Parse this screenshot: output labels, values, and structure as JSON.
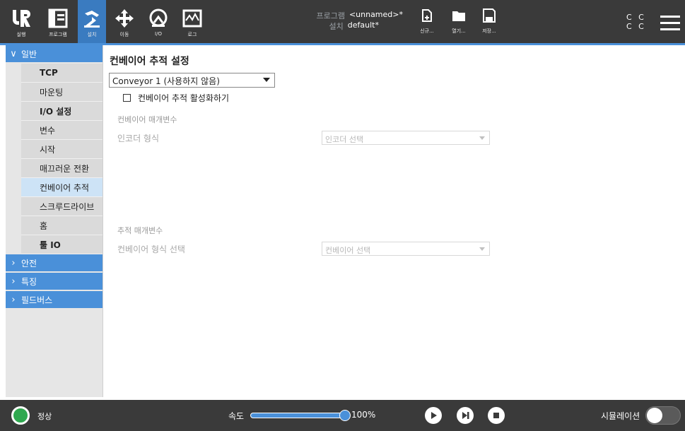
{
  "topbar": {
    "buttons": [
      {
        "label": "실행",
        "icon": "ur-logo-icon"
      },
      {
        "label": "프로그램",
        "icon": "program-icon"
      },
      {
        "label": "설치",
        "icon": "installation-icon"
      },
      {
        "label": "이동",
        "icon": "move-icon"
      },
      {
        "label": "I/O",
        "icon": "io-icon"
      },
      {
        "label": "로그",
        "icon": "log-icon"
      }
    ],
    "program_key": "프로그램",
    "program_value": "<unnamed>*",
    "install_key": "설치",
    "install_value": "default*",
    "file_buttons": [
      {
        "label": "신규...",
        "icon": "new-file-icon"
      },
      {
        "label": "열기...",
        "icon": "open-folder-icon"
      },
      {
        "label": "저장...",
        "icon": "save-icon"
      }
    ],
    "cc_line1": "C C",
    "cc_line2": "C C",
    "accent_color": "#4a90d9"
  },
  "sidebar": {
    "general_label": "일반",
    "items": [
      {
        "label": "TCP"
      },
      {
        "label": "마운팅"
      },
      {
        "label": "I/O 설정"
      },
      {
        "label": "변수"
      },
      {
        "label": "시작"
      },
      {
        "label": "매끄러운 전환"
      },
      {
        "label": "컨베이어 추적"
      },
      {
        "label": "스크루드라이브"
      },
      {
        "label": "홈"
      },
      {
        "label": "툴 IO"
      }
    ],
    "selected": "컨베이어 추적",
    "safety_label": "안전",
    "features_label": "특징",
    "fieldbus_label": "필드버스"
  },
  "main": {
    "title": "컨베이어 추적 설정",
    "conveyor_select": "Conveyor 1 (사용하지 않음)",
    "enable_checkbox_label": "컨베이어 추적 활성화하기",
    "enable_checked": false,
    "conveyor_params_heading": "컨베이어 매개변수",
    "encoder_type_label": "인코더 형식",
    "encoder_placeholder": "인코더 선택",
    "tracking_params_heading": "추적 매개변수",
    "conveyor_type_label": "컨베이어 형식 선택",
    "conveyor_placeholder": "컨베이어 선택"
  },
  "bottombar": {
    "status": "정상",
    "status_color": "#2fa84f",
    "speed_label": "속도",
    "speed_value": "100%",
    "speed_fraction": 1.0,
    "simulation_label": "시뮬레이션",
    "simulation_on": false
  }
}
